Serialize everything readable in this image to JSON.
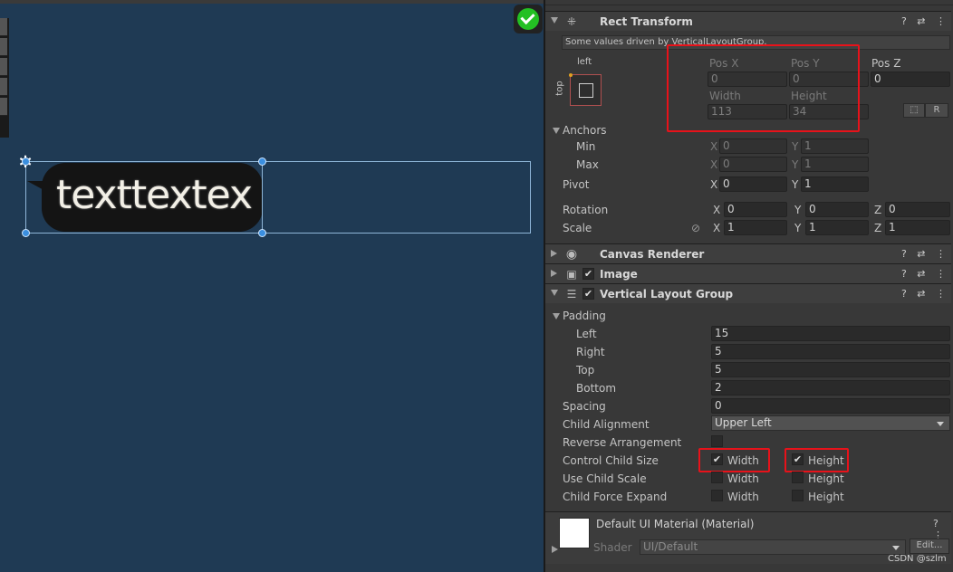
{
  "scene": {
    "bubble_text": "texttextex"
  },
  "rect_transform": {
    "title": "Rect Transform",
    "notice": "Some values driven by VerticalLayoutGroup.",
    "anchor_left": "left",
    "anchor_top": "top",
    "pos_x_label": "Pos X",
    "pos_x": "0",
    "pos_y_label": "Pos Y",
    "pos_y": "0",
    "pos_z_label": "Pos Z",
    "pos_z": "0",
    "width_label": "Width",
    "width": "113",
    "height_label": "Height",
    "height": "34",
    "r_button": "R",
    "anchors_label": "Anchors",
    "min_label": "Min",
    "min_x": "0",
    "min_y": "1",
    "max_label": "Max",
    "max_x": "0",
    "max_y": "1",
    "pivot_label": "Pivot",
    "pivot_x": "0",
    "pivot_y": "1",
    "rotation_label": "Rotation",
    "rot_x": "0",
    "rot_y": "0",
    "rot_z": "0",
    "scale_label": "Scale",
    "scale_x": "1",
    "scale_y": "1",
    "scale_z": "1",
    "axis_x": "X",
    "axis_y": "Y",
    "axis_z": "Z"
  },
  "canvas_renderer": {
    "title": "Canvas Renderer"
  },
  "image": {
    "title": "Image",
    "enabled_mark": "✔"
  },
  "vlg": {
    "title": "Vertical Layout Group",
    "enabled_mark": "✔",
    "padding_label": "Padding",
    "left_label": "Left",
    "left": "15",
    "right_label": "Right",
    "right": "5",
    "top_label": "Top",
    "top": "5",
    "bottom_label": "Bottom",
    "bottom": "2",
    "spacing_label": "Spacing",
    "spacing": "0",
    "child_alignment_label": "Child Alignment",
    "child_alignment": "Upper Left",
    "reverse_label": "Reverse Arrangement",
    "control_size_label": "Control Child Size",
    "use_scale_label": "Use Child Scale",
    "force_expand_label": "Child Force Expand",
    "width_opt": "Width",
    "height_opt": "Height",
    "check_mark": "✔"
  },
  "material": {
    "title": "Default UI Material (Material)",
    "shader_label": "Shader",
    "shader": "UI/Default",
    "edit_button": "Edit..."
  },
  "header_buttons": {
    "help": "?",
    "settings": "⇄",
    "more": "⋮"
  },
  "watermark": "CSDN @szlm",
  "colors": {
    "scene_bg": "#1f3a54",
    "highlight": "#e8121a",
    "ok_green": "#23c023"
  }
}
